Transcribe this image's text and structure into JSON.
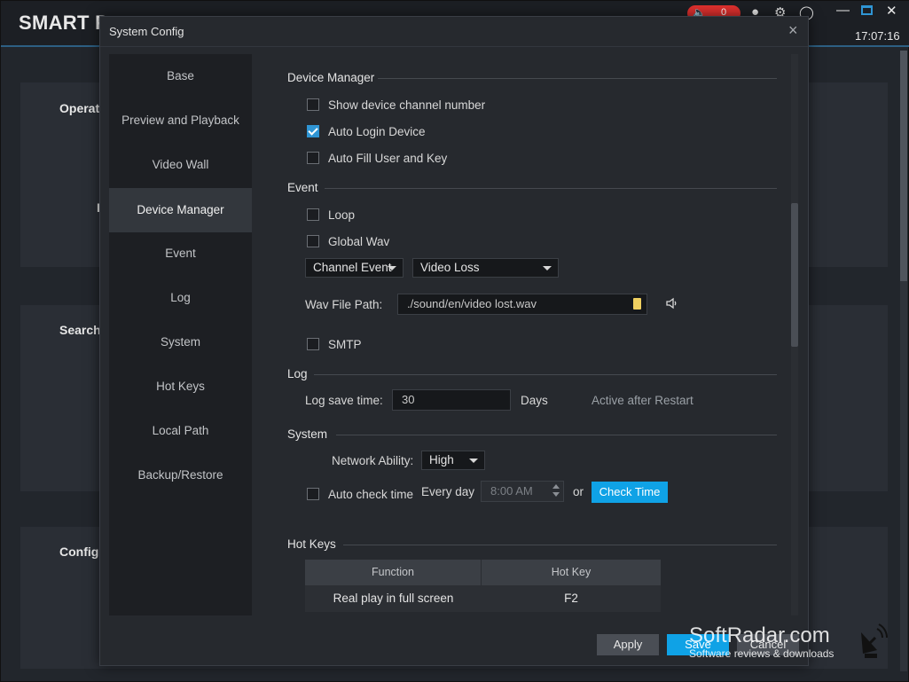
{
  "app": {
    "title_prefix": "SMART P",
    "alarm_count": "0",
    "clock": "17:07:16",
    "bg_labels": [
      "Operat",
      "I",
      "Search",
      "Config"
    ]
  },
  "dialog": {
    "title": "System Config",
    "close": "×"
  },
  "nav": {
    "items": [
      {
        "label": "Base"
      },
      {
        "label": "Preview and Playback"
      },
      {
        "label": "Video Wall"
      },
      {
        "label": "Device Manager"
      },
      {
        "label": "Event"
      },
      {
        "label": "Log"
      },
      {
        "label": "System"
      },
      {
        "label": "Hot Keys"
      },
      {
        "label": "Local Path"
      },
      {
        "label": "Backup/Restore"
      }
    ],
    "active": "Device Manager"
  },
  "device_manager": {
    "title": "Device Manager",
    "show_channel_number": {
      "label": "Show device channel number",
      "checked": false
    },
    "auto_login": {
      "label": "Auto Login Device",
      "checked": true
    },
    "auto_fill": {
      "label": "Auto Fill User and Key",
      "checked": false
    }
  },
  "event": {
    "title": "Event",
    "loop": {
      "label": "Loop",
      "checked": false
    },
    "global_wav": {
      "label": "Global Wav",
      "checked": false
    },
    "event_type": "Channel Event",
    "event_subtype": "Video Loss",
    "wav_label": "Wav File Path:",
    "wav_path": "./sound/en/video lost.wav",
    "smtp": {
      "label": "SMTP",
      "checked": false
    }
  },
  "log": {
    "title": "Log",
    "save_time_label": "Log save time:",
    "save_time_value": "30",
    "unit": "Days",
    "note": "Active after Restart"
  },
  "system": {
    "title": "System",
    "network_label": "Network Ability:",
    "network_value": "High",
    "auto_check": {
      "label": "Auto check time",
      "checked": false
    },
    "every_day": "Every day",
    "time_value": "8:00 AM",
    "or": "or",
    "check_time_button": "Check Time"
  },
  "hot_keys": {
    "title": "Hot Keys",
    "columns": [
      "Function",
      "Hot Key"
    ],
    "rows": [
      {
        "function": "Real play in full screen",
        "key": "F2"
      }
    ]
  },
  "footer": {
    "apply": "Apply",
    "save": "Save",
    "cancel": "Cancel"
  },
  "watermark": {
    "main": "SoftRadar.com",
    "sub": "Software reviews & downloads"
  },
  "colors": {
    "accent": "#0fa2e6",
    "alarm": "#e0302e",
    "checkbox_on": "#2f95d4"
  }
}
